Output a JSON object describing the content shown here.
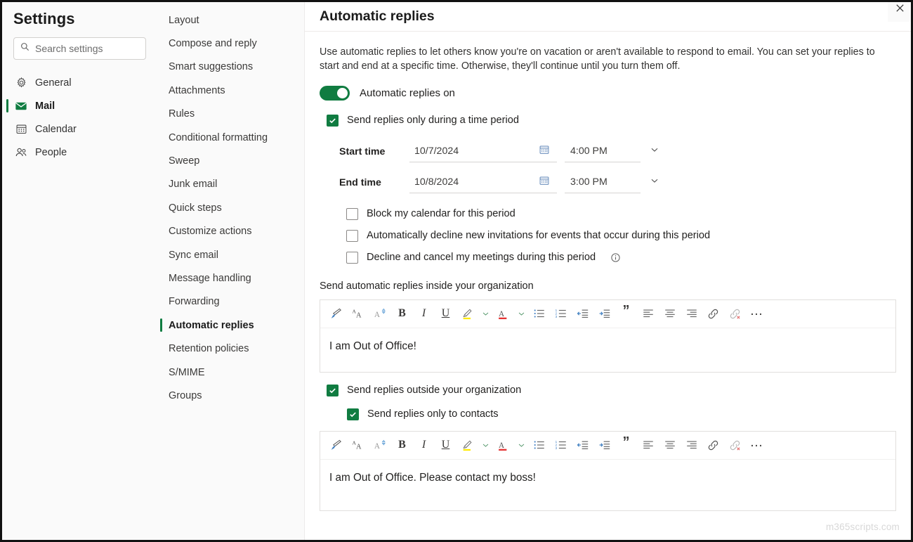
{
  "rail": {
    "title": "Settings",
    "search": {
      "placeholder": "Search settings",
      "value": "",
      "icon": "search-icon"
    },
    "items": [
      {
        "label": "General",
        "icon": "gear-icon",
        "selected": false
      },
      {
        "label": "Mail",
        "icon": "envelope-icon",
        "selected": true
      },
      {
        "label": "Calendar",
        "icon": "calendar-icon",
        "selected": false
      },
      {
        "label": "People",
        "icon": "people-icon",
        "selected": false
      }
    ]
  },
  "subnav": {
    "items": [
      {
        "label": "Layout",
        "selected": false
      },
      {
        "label": "Compose and reply",
        "selected": false
      },
      {
        "label": "Smart suggestions",
        "selected": false
      },
      {
        "label": "Attachments",
        "selected": false
      },
      {
        "label": "Rules",
        "selected": false
      },
      {
        "label": "Conditional formatting",
        "selected": false
      },
      {
        "label": "Sweep",
        "selected": false
      },
      {
        "label": "Junk email",
        "selected": false
      },
      {
        "label": "Quick steps",
        "selected": false
      },
      {
        "label": "Customize actions",
        "selected": false
      },
      {
        "label": "Sync email",
        "selected": false
      },
      {
        "label": "Message handling",
        "selected": false
      },
      {
        "label": "Forwarding",
        "selected": false
      },
      {
        "label": "Automatic replies",
        "selected": true
      },
      {
        "label": "Retention policies",
        "selected": false
      },
      {
        "label": "S/MIME",
        "selected": false
      },
      {
        "label": "Groups",
        "selected": false
      }
    ]
  },
  "main": {
    "title": "Automatic replies",
    "close_icon": "close-icon",
    "intro": "Use automatic replies to let others know you're on vacation or aren't available to respond to email. You can set your replies to start and end at a specific time. Otherwise, they'll continue until you turn them off.",
    "toggle": {
      "label": "Automatic replies on",
      "on": true
    },
    "time_period": {
      "checkbox_label": "Send replies only during a time period",
      "checked": true,
      "start": {
        "label": "Start time",
        "date": "10/7/2024",
        "time": "4:00 PM",
        "calendar_icon": "calendar-icon",
        "chevron_icon": "chevron-down-icon"
      },
      "end": {
        "label": "End time",
        "date": "10/8/2024",
        "time": "3:00 PM",
        "calendar_icon": "calendar-icon",
        "chevron_icon": "chevron-down-icon"
      }
    },
    "suboptions": [
      {
        "label": "Block my calendar for this period",
        "checked": false,
        "info": false
      },
      {
        "label": "Automatically decline new invitations for events that occur during this period",
        "checked": false,
        "info": false
      },
      {
        "label": "Decline and cancel my meetings during this period",
        "checked": false,
        "info": true,
        "info_icon": "info-icon"
      }
    ],
    "inside_section_label": "Send automatic replies inside your organization",
    "inside_editor_text": "I am Out of Office!",
    "outside": {
      "checkbox_label": "Send replies outside your organization",
      "checked": true,
      "contacts_label": "Send replies only to contacts",
      "contacts_checked": true
    },
    "outside_editor_text": "I am Out of Office. Please contact my boss!",
    "toolbar": [
      {
        "name": "format-painter-icon",
        "kind": "svg-painter"
      },
      {
        "name": "font-size-icon",
        "kind": "txt",
        "text": "AA"
      },
      {
        "name": "font-grow-icon",
        "kind": "svg-grow"
      },
      {
        "name": "bold-button",
        "kind": "b",
        "text": "B"
      },
      {
        "name": "italic-button",
        "kind": "i",
        "text": "I"
      },
      {
        "name": "underline-button",
        "kind": "u",
        "text": "U"
      },
      {
        "name": "highlight-icon",
        "kind": "svg-highlight",
        "chevron": true
      },
      {
        "name": "font-color-icon",
        "kind": "svg-fontcolor",
        "chevron": true
      },
      {
        "name": "bulleted-list-icon",
        "kind": "svg-bullets"
      },
      {
        "name": "numbered-list-icon",
        "kind": "svg-numbers"
      },
      {
        "name": "decrease-indent-icon",
        "kind": "svg-outdent"
      },
      {
        "name": "increase-indent-icon",
        "kind": "svg-indent"
      },
      {
        "name": "quote-icon",
        "kind": "q",
        "text": "”"
      },
      {
        "name": "align-left-icon",
        "kind": "svg-alignleft"
      },
      {
        "name": "align-center-icon",
        "kind": "svg-aligncenter"
      },
      {
        "name": "align-right-icon",
        "kind": "svg-alignright"
      },
      {
        "name": "insert-link-icon",
        "kind": "svg-link"
      },
      {
        "name": "remove-link-icon",
        "kind": "svg-unlink"
      },
      {
        "name": "more-options-icon",
        "kind": "dots",
        "text": "…"
      }
    ]
  },
  "watermark": "m365scripts.com",
  "colors": {
    "accent_green": "#107c41",
    "text": "#201f1e",
    "panel_bg": "#fafafa"
  }
}
